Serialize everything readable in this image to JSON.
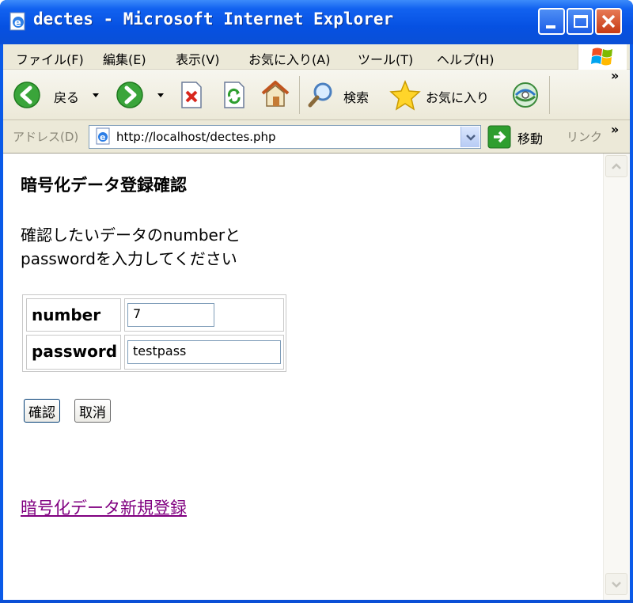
{
  "window": {
    "title": "dectes - Microsoft Internet Explorer"
  },
  "menubar": {
    "items": [
      "ファイル(F)",
      "編集(E)",
      "表示(V)",
      "お気に入り(A)",
      "ツール(T)",
      "ヘルプ(H)"
    ]
  },
  "toolbar": {
    "back_label": "戻る",
    "search_label": "検索",
    "favorites_label": "お気に入り",
    "overflow": "»"
  },
  "addressbar": {
    "label": "アドレス(D)",
    "url": "http://localhost/dectes.php",
    "go_label": "移動",
    "links_label": "リンク",
    "overflow": "»"
  },
  "page": {
    "title": "暗号化データ登録確認",
    "instruction_line1": "確認したいデータのnumberと",
    "instruction_line2": "passwordを入力してください",
    "form": {
      "number_label": "number",
      "number_value": "7",
      "password_label": "password",
      "password_value": "testpass"
    },
    "confirm_button": "確認",
    "cancel_button": "取消",
    "new_link": "暗号化データ新規登録"
  },
  "colors": {
    "titlebar": "#0651e2",
    "chrome": "#ece9d8",
    "link_visited": "#800080"
  }
}
